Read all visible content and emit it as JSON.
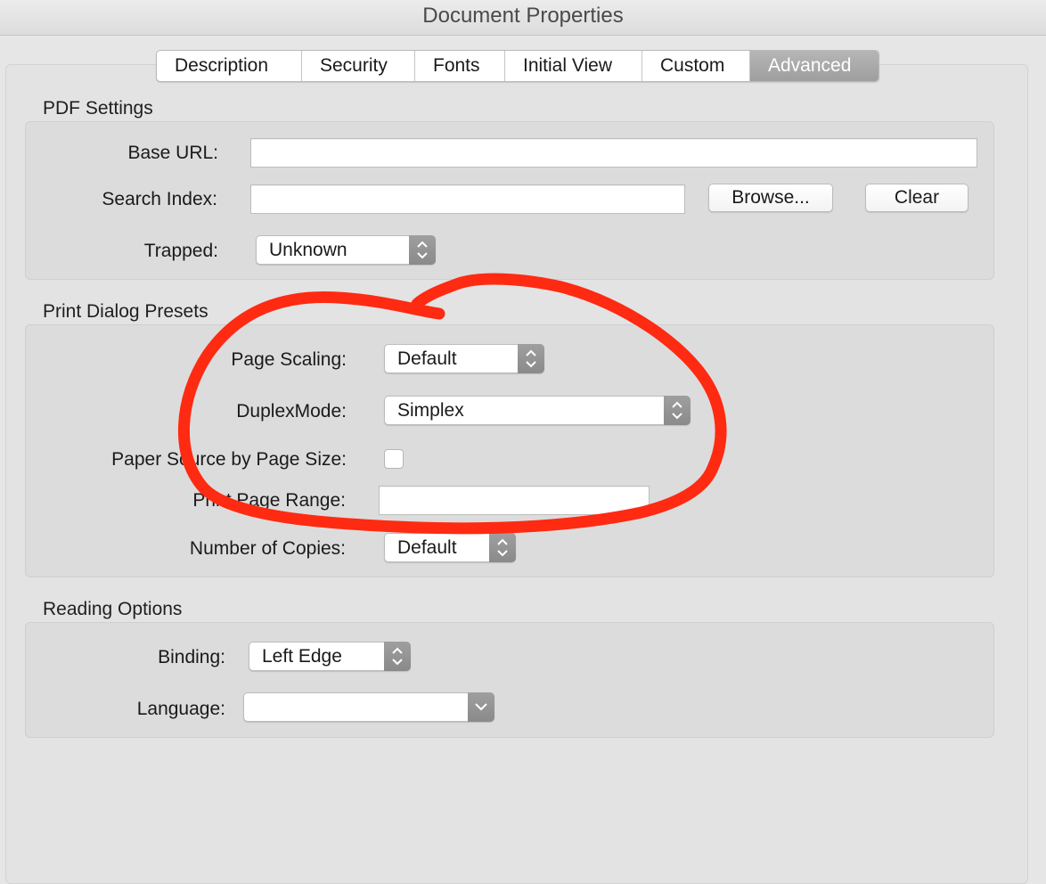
{
  "window": {
    "title": "Document Properties"
  },
  "tabs": [
    {
      "label": "Description"
    },
    {
      "label": "Security"
    },
    {
      "label": "Fonts"
    },
    {
      "label": "Initial View"
    },
    {
      "label": "Custom"
    },
    {
      "label": "Advanced",
      "selected": true
    }
  ],
  "pdf_settings": {
    "title": "PDF Settings",
    "base_url_label": "Base URL:",
    "base_url_value": "",
    "search_index_label": "Search Index:",
    "search_index_value": "",
    "browse_button": "Browse...",
    "clear_button": "Clear",
    "trapped_label": "Trapped:",
    "trapped_value": "Unknown"
  },
  "print_presets": {
    "title": "Print Dialog Presets",
    "page_scaling_label": "Page Scaling:",
    "page_scaling_value": "Default",
    "duplex_label": "DuplexMode:",
    "duplex_value": "Simplex",
    "paper_source_label": "Paper Source by Page Size:",
    "paper_source_checked": false,
    "print_range_label": "Print Page Range:",
    "print_range_value": "",
    "copies_label": "Number of Copies:",
    "copies_value": "Default"
  },
  "reading_options": {
    "title": "Reading Options",
    "binding_label": "Binding:",
    "binding_value": "Left Edge",
    "language_label": "Language:",
    "language_value": ""
  },
  "icons": {
    "stepper": "up-down-chevron-icon",
    "dropdown": "chevron-down-icon"
  },
  "colors": {
    "annotation": "#ff2a12",
    "selected_tab": "#a7a7a7"
  }
}
